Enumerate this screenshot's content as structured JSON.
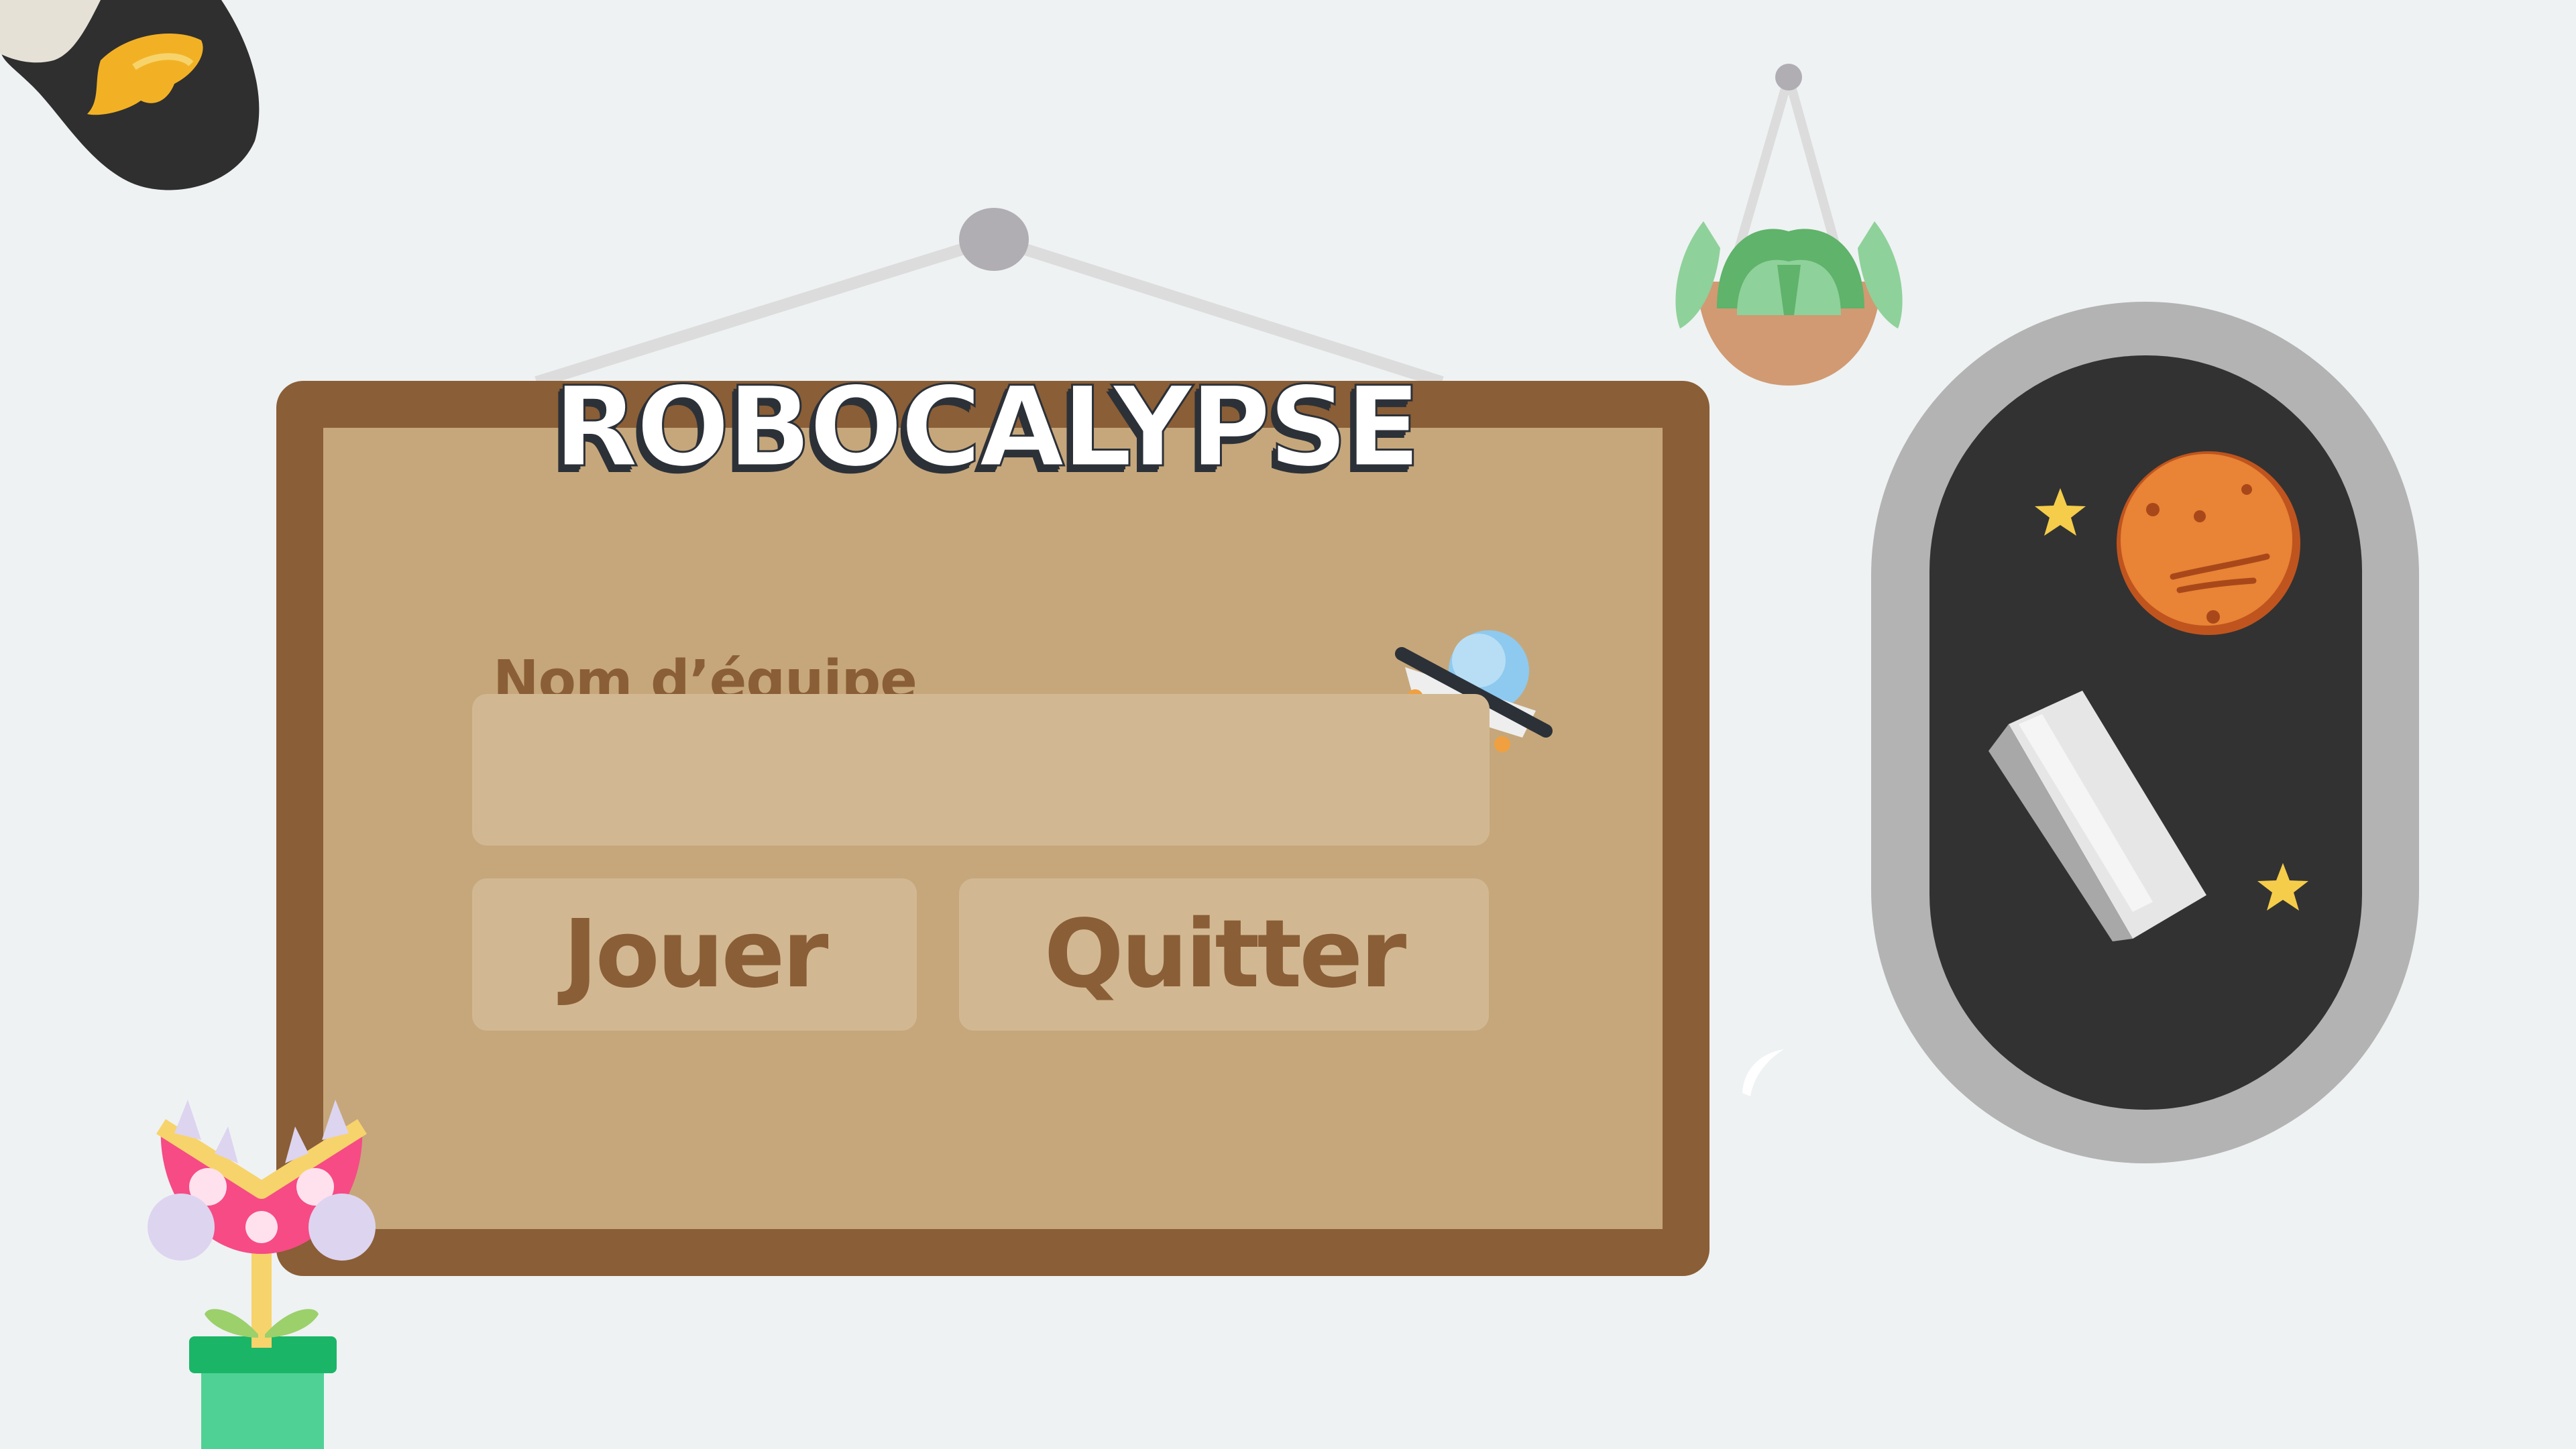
{
  "game": {
    "title": "ROBOCALYPSE"
  },
  "form": {
    "team_name_label": "Nom d’équipe",
    "team_name_value": "",
    "team_name_placeholder": ""
  },
  "buttons": {
    "play_label": "Jouer",
    "quit_label": "Quitter"
  },
  "colors": {
    "background": "#eef2f3",
    "board_frame": "#8a5e36",
    "board_inner": "#c6a77b",
    "field": "#d2b892",
    "text_brown": "#8a5e36",
    "porthole_rim": "#b3b3b3",
    "space": "#323232"
  },
  "icons": [
    "corner-planet-icon",
    "hanging-plant-icon",
    "ufo-icon",
    "mars-planet-icon",
    "star-icon",
    "space-debris-icon",
    "piranha-plant-icon"
  ]
}
